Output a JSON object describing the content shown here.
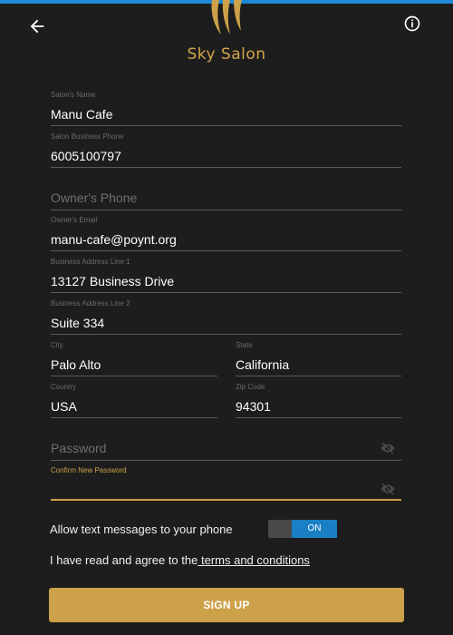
{
  "header": {
    "brand": "Sky Salon",
    "accent_color": "#cda149",
    "top_strip_color": "#1d8ad6"
  },
  "form": {
    "salon_name": {
      "label": "Salon's Name",
      "value": "Manu Cafe"
    },
    "business_phone": {
      "label": "Salon Business Phone",
      "value": "6005100797"
    },
    "owner_phone": {
      "placeholder": "Owner's Phone"
    },
    "owner_email": {
      "label": "Owner's Email",
      "value": "manu-cafe@poynt.org"
    },
    "address1": {
      "label": "Business Address Line 1",
      "value": "13127 Business Drive"
    },
    "address2": {
      "label": "Business Address Line 2",
      "value": "Suite 334"
    },
    "city": {
      "label": "City",
      "value": "Palo Alto"
    },
    "state": {
      "label": "State",
      "value": "California"
    },
    "country": {
      "label": "Country",
      "value": "USA"
    },
    "zip": {
      "label": "Zip Code",
      "value": "94301"
    },
    "password": {
      "placeholder": "Password"
    },
    "confirm_password": {
      "label": "Confirm New Password",
      "value": ""
    }
  },
  "sms": {
    "label": "Allow text messages to your phone",
    "toggle": "ON"
  },
  "terms": {
    "prefix": "I have read and agree to the",
    "link": " terms and conditions"
  },
  "signup_label": "SIGN UP",
  "icons": [
    "back-arrow-icon",
    "info-icon",
    "salon-logo-icon",
    "eye-off-icon"
  ]
}
